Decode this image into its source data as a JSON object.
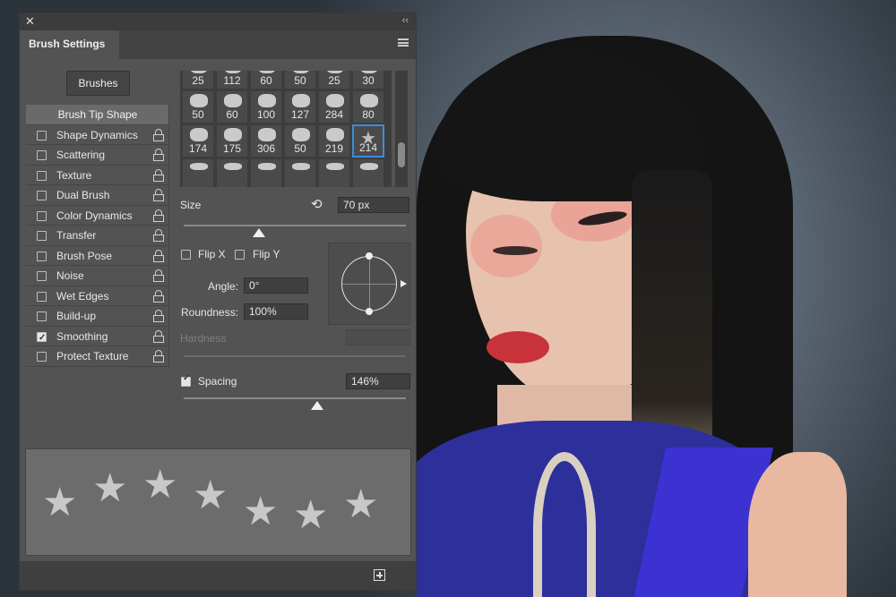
{
  "panel": {
    "close_glyph": "✕",
    "collapse_glyph": "‹‹",
    "tab_title": "Brush Settings",
    "brushes_button": "Brushes",
    "options": [
      {
        "label": "Brush Tip Shape",
        "header": true
      },
      {
        "label": "Shape Dynamics",
        "checked": false,
        "locked": true
      },
      {
        "label": "Scattering",
        "checked": false,
        "locked": true
      },
      {
        "label": "Texture",
        "checked": false,
        "locked": true
      },
      {
        "label": "Dual Brush",
        "checked": false,
        "locked": true
      },
      {
        "label": "Color Dynamics",
        "checked": false,
        "locked": true
      },
      {
        "label": "Transfer",
        "checked": false,
        "locked": true
      },
      {
        "label": "Brush Pose",
        "checked": false,
        "locked": true
      },
      {
        "label": "Noise",
        "checked": false,
        "locked": true
      },
      {
        "label": "Wet Edges",
        "checked": false,
        "locked": true
      },
      {
        "label": "Build-up",
        "checked": false,
        "locked": true
      },
      {
        "label": "Smoothing",
        "checked": true,
        "locked": true
      },
      {
        "label": "Protect Texture",
        "checked": false,
        "locked": true
      }
    ],
    "brush_tips": [
      [
        "25",
        "112",
        "60",
        "50",
        "25",
        "30"
      ],
      [
        "50",
        "60",
        "100",
        "127",
        "284",
        "80"
      ],
      [
        "174",
        "175",
        "306",
        "50",
        "219",
        "214"
      ]
    ],
    "selected_tip": "214",
    "size": {
      "label": "Size",
      "value": "70 px",
      "slider_fraction": 0.34
    },
    "flip_x": {
      "label": "Flip X",
      "checked": false
    },
    "flip_y": {
      "label": "Flip Y",
      "checked": false
    },
    "angle": {
      "label": "Angle:",
      "value": "0°"
    },
    "roundness": {
      "label": "Roundness:",
      "value": "100%"
    },
    "hardness": {
      "label": "Hardness",
      "value": ""
    },
    "spacing": {
      "label": "Spacing",
      "checked": true,
      "value": "146%",
      "slider_fraction": 0.6
    },
    "preview_star_count": 7,
    "selection_color": "#3c8cdc"
  }
}
